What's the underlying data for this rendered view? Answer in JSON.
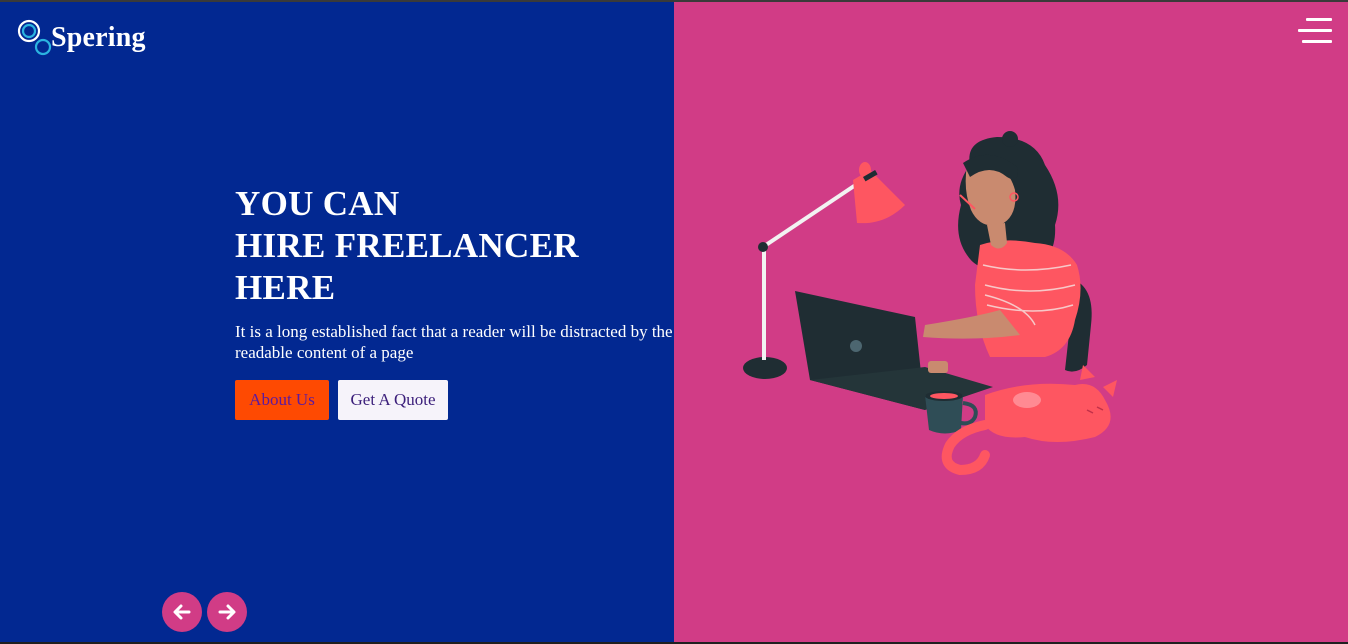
{
  "brand": {
    "name": "Spering",
    "logo_icon": "double-circle-logo-icon"
  },
  "header": {
    "menu_icon": "hamburger-menu-icon"
  },
  "hero": {
    "title_line1": "YOU CAN",
    "title_line2": "HIRE FREELANCER",
    "title_line3": "HERE",
    "description": "It is a long established fact that a reader will be distracted by the readable content of a page",
    "about_button": "About Us",
    "quote_button": "Get A Quote"
  },
  "slider": {
    "prev_icon": "arrow-left-icon",
    "next_icon": "arrow-right-icon"
  },
  "illustration": {
    "icon": "woman-working-laptop-illustration"
  },
  "colors": {
    "left_bg": "#022891",
    "right_bg": "#d13c86",
    "accent_button": "#fe4a02",
    "light_button": "#f6f3fa"
  }
}
